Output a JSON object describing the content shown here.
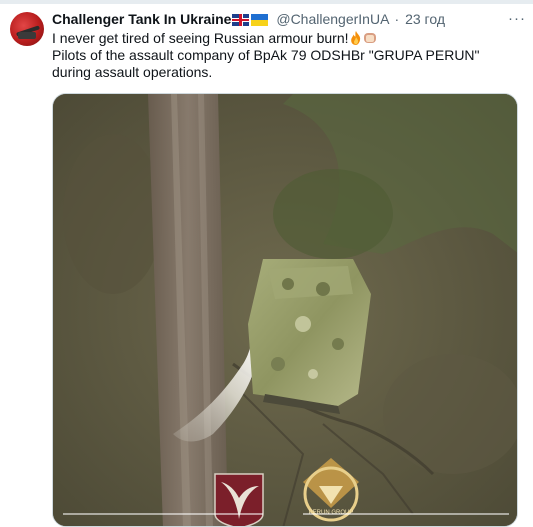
{
  "tweet": {
    "display_name": "Challenger Tank In Ukraine",
    "handle": "@ChallengerInUA",
    "separator": "·",
    "time": "23 год",
    "more_label": "···",
    "text_line1": "I never get tired of seeing Russian armour burn!",
    "text_line2": "Pilots of the assault company of BpAk 79 ODSHBr \"GRUPA PERUN\" during assault operations.",
    "icons": [
      "uk-flag",
      "ukraine-flag",
      "fire-emoji",
      "bread-emoji",
      "more-icon"
    ],
    "media": {
      "type": "video",
      "logo_text": "PERUN GROUP"
    }
  }
}
